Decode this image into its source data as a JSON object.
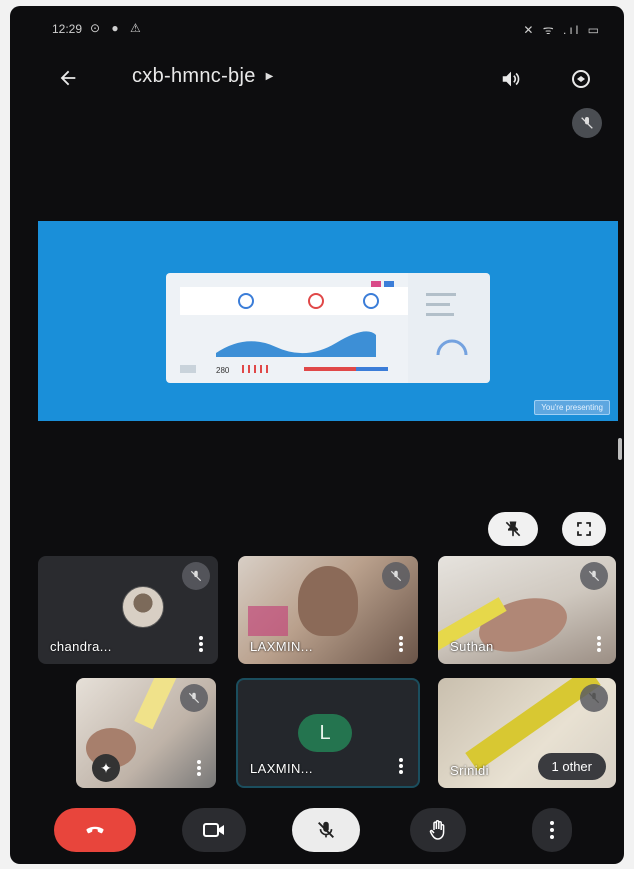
{
  "status_bar": {
    "time": "12:29",
    "left_icons": "⊙ ● ⚠",
    "right_icons": "✕ ᯤ .ıl ▭"
  },
  "header": {
    "title": "cxb-hmnc-bje"
  },
  "share": {
    "presenting_label": "You're presenting",
    "dashboard_number": "280"
  },
  "tiles": [
    {
      "name": "chandra...",
      "muted": true
    },
    {
      "name": "LAXMIN...",
      "muted": true
    },
    {
      "name": "Suthan",
      "muted": true
    },
    {
      "name": "",
      "muted": true
    },
    {
      "name": "LAXMIN...",
      "initial": "L",
      "muted": false
    },
    {
      "name": "Srinidi",
      "muted": true,
      "others_label": "1 other"
    }
  ],
  "colors": {
    "accent_blue": "#1a8fd9",
    "end_call_red": "#e8453c",
    "avatar_green": "#24744f"
  },
  "icons": [
    "back-arrow-icon",
    "speaker-icon",
    "switch-camera-icon",
    "mic-off-icon",
    "pin-off-icon",
    "fullscreen-icon",
    "end-call-icon",
    "camera-icon",
    "hand-icon",
    "more-vert-icon",
    "effects-icon"
  ]
}
